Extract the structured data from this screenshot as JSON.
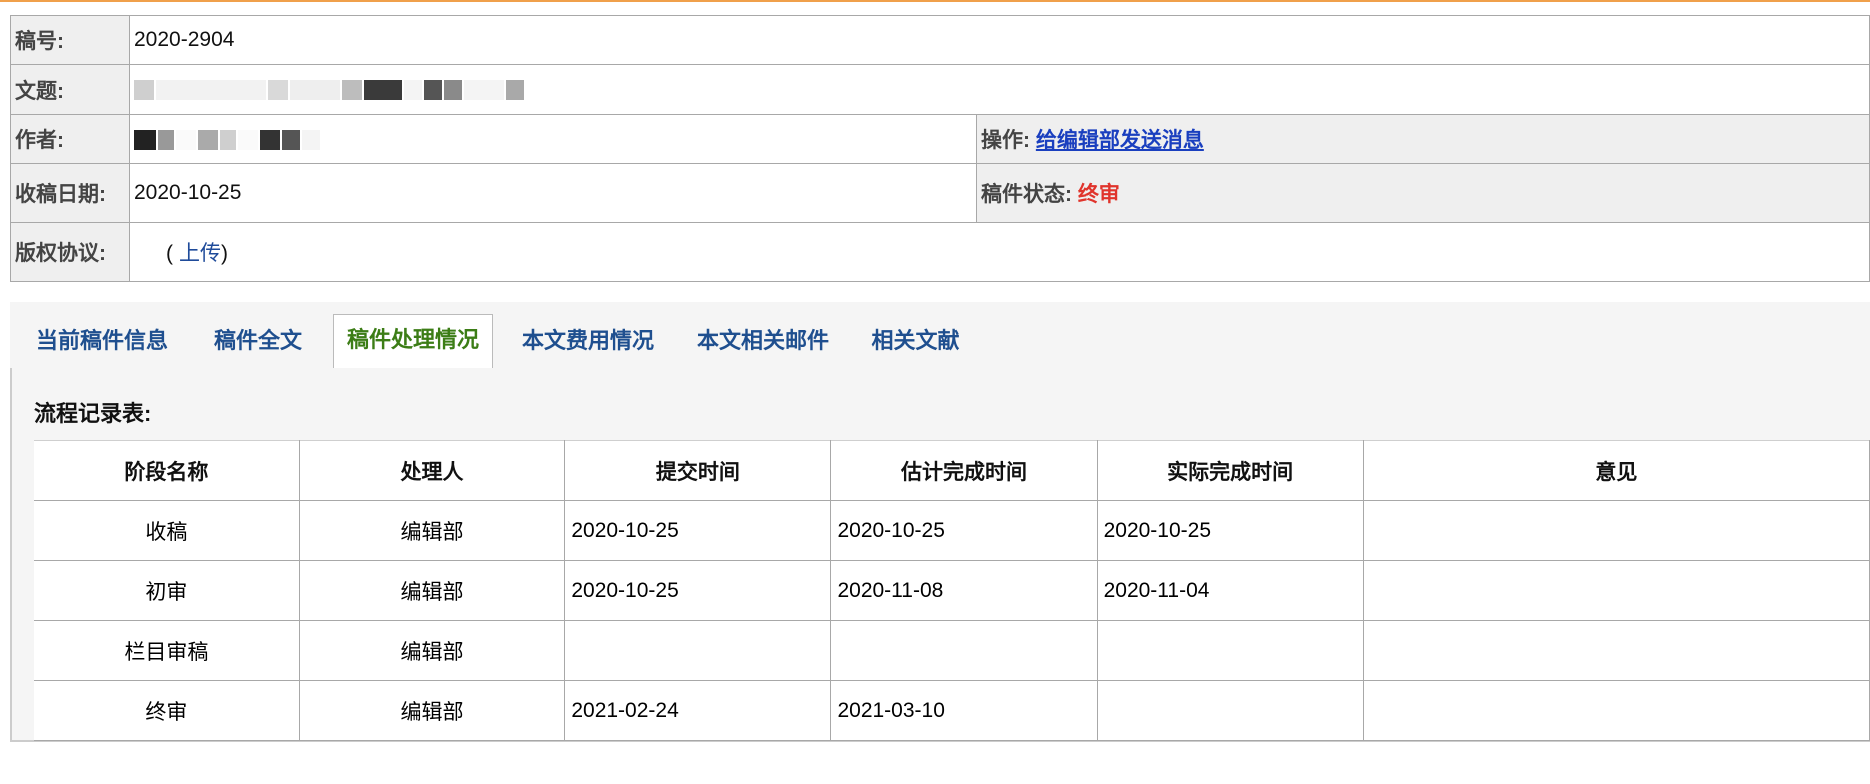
{
  "header": {
    "manuscript_no_label": "稿号:",
    "manuscript_no": "2020-2904",
    "title_label": "文题:",
    "author_label": "作者:",
    "action_label": "操作:",
    "action_link": "给编辑部发送消息",
    "received_label": "收稿日期:",
    "received_date": "2020-10-25",
    "status_label": "稿件状态:",
    "status_value": "终审",
    "copyright_label": "版权协议:",
    "copyright_open": "(",
    "copyright_upload": "上传",
    "copyright_close": ")"
  },
  "tabs": [
    {
      "label": "当前稿件信息"
    },
    {
      "label": "稿件全文"
    },
    {
      "label": "稿件处理情况"
    },
    {
      "label": "本文费用情况"
    },
    {
      "label": "本文相关邮件"
    },
    {
      "label": "相关文献"
    }
  ],
  "active_tab": "稿件处理情况",
  "flow": {
    "title": "流程记录表:",
    "columns": [
      "阶段名称",
      "处理人",
      "提交时间",
      "估计完成时间",
      "实际完成时间",
      "意见"
    ],
    "rows": [
      [
        "收稿",
        "编辑部",
        "2020-10-25",
        "2020-10-25",
        "2020-10-25",
        ""
      ],
      [
        "初审",
        "编辑部",
        "2020-10-25",
        "2020-11-08",
        "2020-11-04",
        ""
      ],
      [
        "栏目审稿",
        "编辑部",
        "",
        "",
        "",
        ""
      ],
      [
        "终审",
        "编辑部",
        "2021-02-24",
        "2021-03-10",
        "",
        ""
      ]
    ]
  },
  "colors": {
    "accent_line": "#f0a04b",
    "tab_text": "#1f4f8f",
    "tab_active_text": "#3c7d16",
    "status_red": "#e0342c",
    "link_blue": "#1a3fbf"
  }
}
